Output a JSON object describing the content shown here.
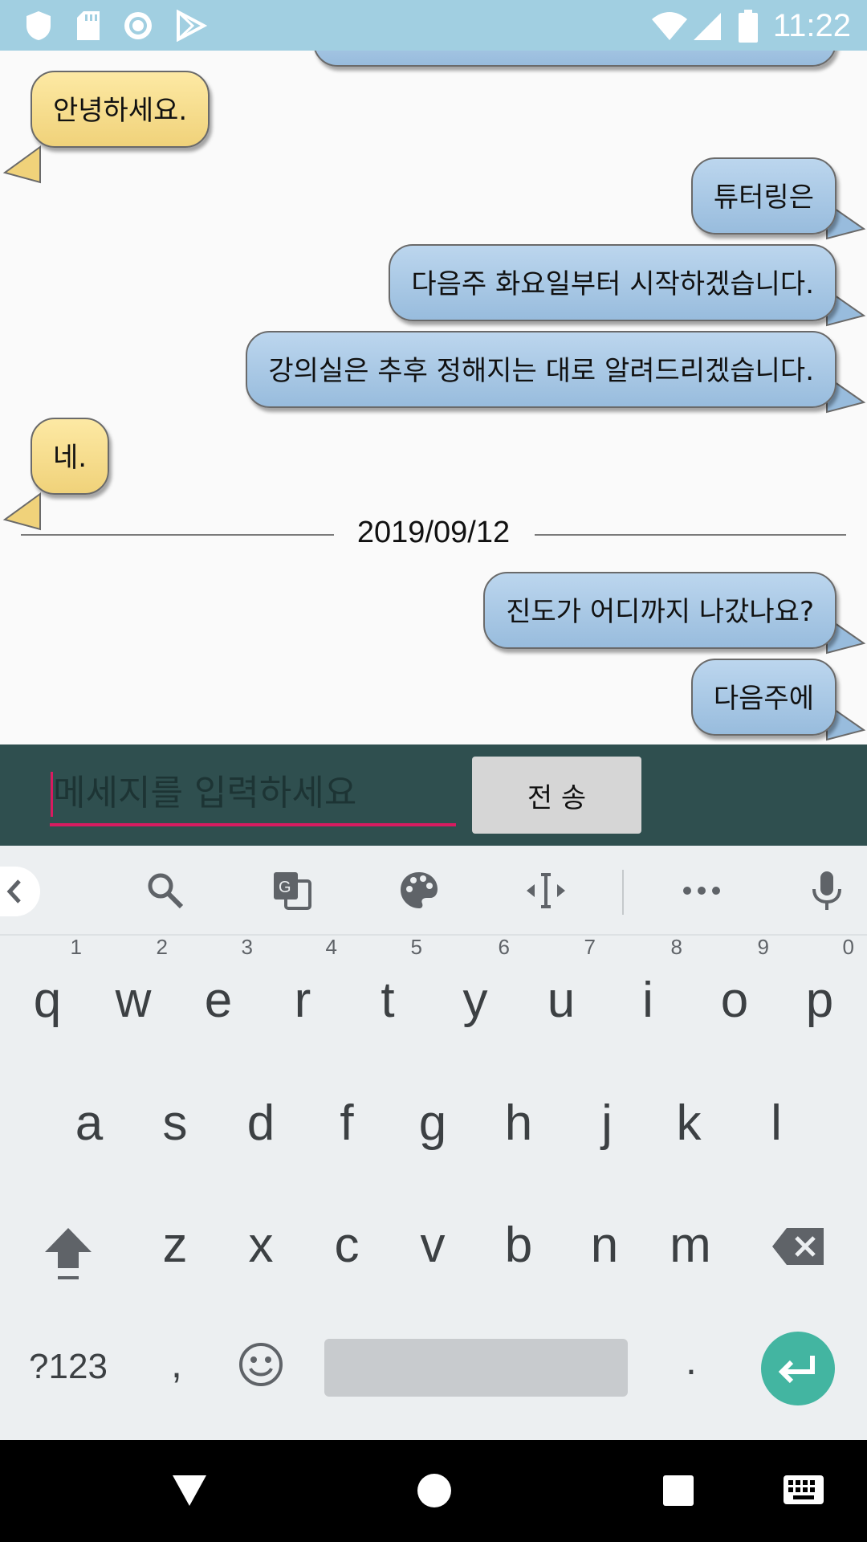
{
  "status_bar": {
    "time": "11:22"
  },
  "chat": {
    "messages": [
      {
        "side": "in",
        "text": "안녕하세요."
      },
      {
        "side": "out",
        "text": "튜터링은"
      },
      {
        "side": "out",
        "text": "다음주 화요일부터 시작하겠습니다."
      },
      {
        "side": "out",
        "text": "강의실은 추후 정해지는 대로 알려드리겠습니다."
      },
      {
        "side": "in",
        "text": "네."
      },
      {
        "side": "out",
        "text": "진도가 어디까지 나갔나요?"
      },
      {
        "side": "out",
        "text": "다음주에"
      }
    ],
    "date_separator": "2019/09/12"
  },
  "input_bar": {
    "placeholder": "메세지를 입력하세요",
    "send_label": "전 송"
  },
  "keyboard": {
    "row1": [
      "q",
      "w",
      "e",
      "r",
      "t",
      "y",
      "u",
      "i",
      "o",
      "p"
    ],
    "row1_hints": [
      "1",
      "2",
      "3",
      "4",
      "5",
      "6",
      "7",
      "8",
      "9",
      "0"
    ],
    "row2": [
      "a",
      "s",
      "d",
      "f",
      "g",
      "h",
      "j",
      "k",
      "l"
    ],
    "row3": [
      "z",
      "x",
      "c",
      "v",
      "b",
      "n",
      "m"
    ],
    "symbols_label": "?123",
    "comma": ",",
    "period": ".",
    "toolbar_icons": [
      "back-icon",
      "search-icon",
      "translate-icon",
      "palette-icon",
      "text-cursor-icon",
      "more-icon",
      "mic-icon"
    ]
  },
  "colors": {
    "status_bar": "#a1cfe1",
    "incoming_bubble": "#f5dc8c",
    "outgoing_bubble": "#a8c8e6",
    "input_bar": "#2f4f4f",
    "accent": "#d81b60",
    "enter_key": "#43b5a1"
  }
}
